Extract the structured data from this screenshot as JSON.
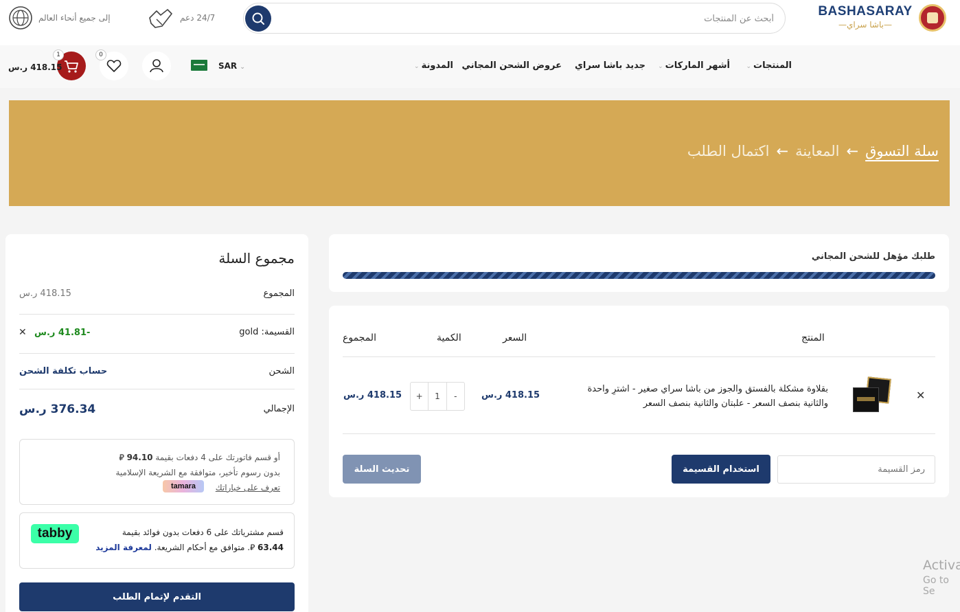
{
  "header": {
    "logo_text": "BASHASARAY",
    "logo_subtext": "باشا سراي",
    "search_placeholder": "أبحث عن المنتجات",
    "support_text": "24/7 دعم",
    "worldwide_text": "إلى جميع أنحاء العالم"
  },
  "nav": {
    "items": [
      {
        "label": "المنتجات",
        "has_dropdown": true
      },
      {
        "label": "أشهر الماركات",
        "has_dropdown": true
      },
      {
        "label": "جديد باشا سراي",
        "has_dropdown": false
      },
      {
        "label": "عروض الشحن المجاني",
        "has_dropdown": false
      },
      {
        "label": "المدونة",
        "has_dropdown": true
      }
    ],
    "currency": "SAR",
    "flag_label": "SAR",
    "wishlist_count": "0",
    "cart_count": "1",
    "cart_total": "418.15 ر.س"
  },
  "banner": {
    "step1": "سلة التسوق",
    "step2": "المعاينة",
    "step3": "اكتمال الطلب",
    "arrow": "←"
  },
  "shipping": {
    "label": "طلبك مؤهل للشحن المجاني",
    "progress": 1.0
  },
  "cart": {
    "headers": {
      "product": "المنتج",
      "price": "السعر",
      "quantity": "الكمية",
      "subtotal": "المجموع"
    },
    "items": [
      {
        "name_line1": "بقلاوة مشكلة بالفستق والجوز من باشا سراي صغير - اشترِ واحدة",
        "name_line2": "والثانية بنصف السعر - علبتان والثانية بنصف السعر",
        "price": "418.15 ر.س",
        "quantity": "1",
        "minus": "-",
        "plus": "+",
        "subtotal": "418.15 ر.س"
      }
    ],
    "coupon_placeholder": "رمز القسيمة",
    "apply_coupon_label": "استخدام القسيمة",
    "update_cart_label": "تحديث السلة"
  },
  "totals": {
    "title": "مجموع السلة",
    "subtotal_label": "المجموع",
    "subtotal_value": "418.15 ر.س",
    "coupon_label": "القسيمة: gold",
    "coupon_value": "-41.81 ر.س",
    "shipping_label": "الشحن",
    "shipping_link": "حساب تكلفة الشحن",
    "total_label": "الإجمالي",
    "total_value": "376.34 ر.س",
    "checkout_label": "التقدم لإتمام الطلب"
  },
  "tamara": {
    "line1_prefix": "أو قسم فاتورتك على 4 دفعات بقيمة",
    "line1_amount": "94.10",
    "line2": "بدون رسوم تأخير، متوافقة مع الشريعة الإسلامية",
    "link": "تعرف على خياراتك",
    "brand": "tamara"
  },
  "tabby": {
    "line1": "قسم مشترياتك على 6 دفعات بدون فوائد بقيمة",
    "amount": "63.44",
    "line2": ". متوافق مع أحكام الشريعة.",
    "link": "لمعرفة المزيد",
    "brand": "tabby"
  },
  "os_watermark": {
    "line1": "Activa",
    "line2": "Go to Se"
  },
  "colors": {
    "brand_blue": "#1e3a6d",
    "banner_gold": "#d5a955",
    "cart_red": "#a61b1b",
    "discount_green": "#1e8a1e",
    "tabby_green": "#3bffa8"
  }
}
